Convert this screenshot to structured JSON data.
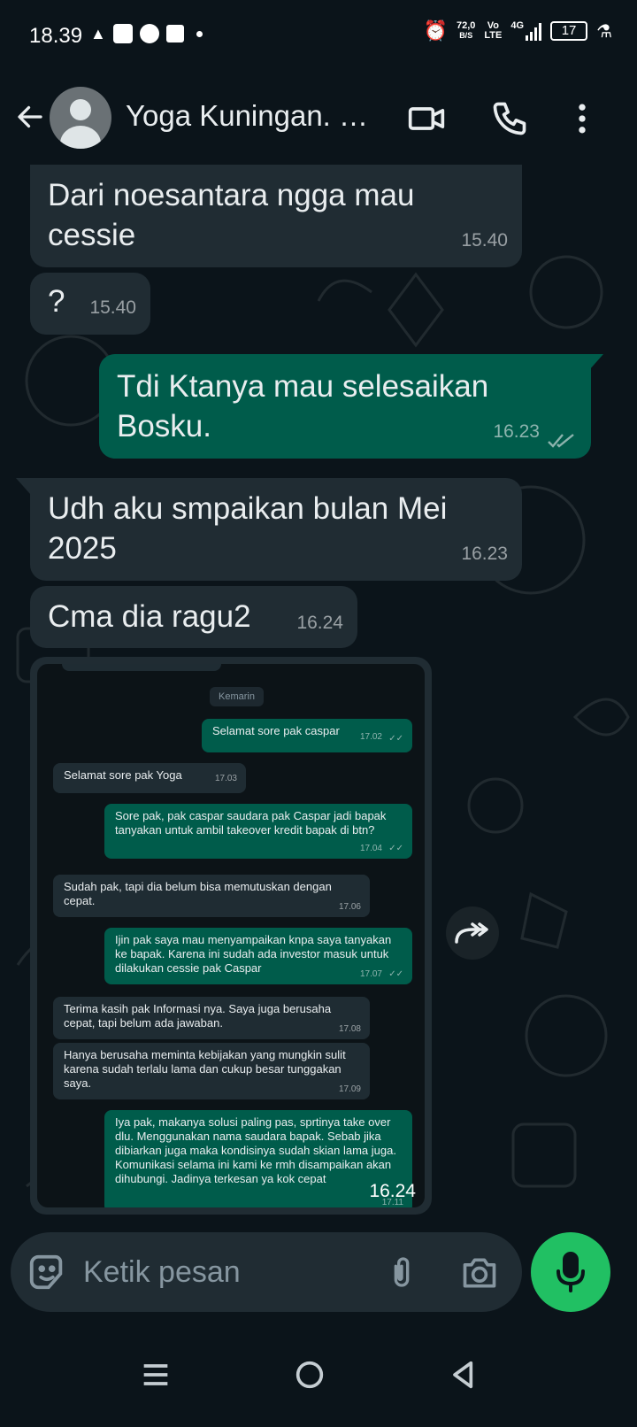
{
  "status_bar": {
    "time": "18.39",
    "speed_value": "72,0",
    "speed_unit": "B/S",
    "volte_top": "Vo",
    "volte_bottom": "LTE",
    "network": "4G",
    "battery": "17"
  },
  "header": {
    "contact_name": "Yoga Kuningan. B..."
  },
  "messages": [
    {
      "direction": "in",
      "text": "Dari noesantara ngga mau cessie",
      "time": "15.40"
    },
    {
      "direction": "in",
      "text": "?",
      "time": "15.40"
    },
    {
      "direction": "out",
      "text": "Tdi Ktanya mau selesaikan Bosku.",
      "time": "16.23"
    },
    {
      "direction": "in",
      "text": "Udh aku smpaikan bulan Mei 2025",
      "time": "16.23"
    },
    {
      "direction": "in",
      "text": "Cma dia ragu2",
      "time": "16.24"
    }
  ],
  "image_message": {
    "time": "16.24",
    "screenshot": {
      "date_chip": "Kemarin",
      "messages": [
        {
          "direction": "out",
          "text": "Selamat sore pak caspar",
          "time": "17.02"
        },
        {
          "direction": "in",
          "text": "Selamat sore pak Yoga",
          "time": "17.03"
        },
        {
          "direction": "out",
          "text": "Sore pak, pak caspar saudara pak Caspar jadi bapak tanyakan untuk ambil takeover kredit bapak di btn?",
          "time": "17.04"
        },
        {
          "direction": "in",
          "text": "Sudah pak, tapi dia belum bisa memutuskan dengan cepat.",
          "time": "17.06"
        },
        {
          "direction": "out",
          "text": "Ijin pak saya mau menyampaikan knpa saya tanyakan ke bapak. Karena ini sudah ada investor masuk untuk dilakukan cessie pak Caspar",
          "time": "17.07"
        },
        {
          "direction": "in",
          "text": "Terima kasih pak Informasi nya. Saya juga berusaha cepat, tapi belum ada jawaban.",
          "time": "17.08"
        },
        {
          "direction": "in",
          "text": "Hanya berusaha meminta kebijakan yang mungkin sulit karena sudah terlalu lama dan cukup besar tunggakan saya.",
          "time": "17.09"
        },
        {
          "direction": "out",
          "text": "Iya pak, makanya solusi paling pas, sprtinya take over dlu. Menggunakan nama saudara bapak. Sebab jika dibiarkan juga maka kondisinya sudah skian lama juga. Komunikasi selama ini kami ke rmh disampaikan akan dihubungi. Jadinya terkesan ya kok cepat",
          "time": "17.11"
        }
      ]
    }
  },
  "input": {
    "placeholder": "Ketik pesan"
  },
  "icons": {
    "back": "arrow-left-icon",
    "video": "video-call-icon",
    "call": "phone-icon",
    "menu": "more-vert-icon",
    "emoji": "sticker-emoji-icon",
    "attach": "paperclip-icon",
    "camera": "camera-icon",
    "mic": "microphone-icon",
    "forward": "forward-icon"
  },
  "colors": {
    "background": "#0b141a",
    "incoming_bubble": "#202c33",
    "outgoing_bubble": "#005c4b",
    "accent": "#21c063"
  }
}
